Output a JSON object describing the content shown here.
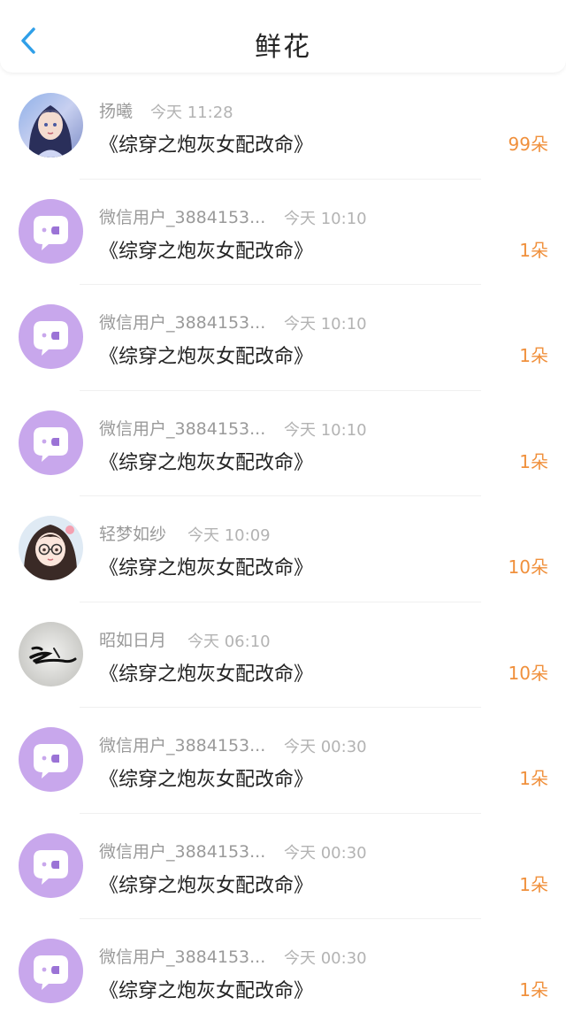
{
  "header": {
    "title": "鲜花",
    "accent": "#2f9fe8"
  },
  "colors": {
    "count": "#f0903c",
    "avatar_default": "#c8a7ec"
  },
  "items": [
    {
      "name": "扬曦",
      "time": "今天 11:28",
      "book": "《综穿之炮灰女配改命》",
      "count": "99朵",
      "avatar": "girl-anime-avatar"
    },
    {
      "name": "微信用户_3884153...",
      "time": "今天 10:10",
      "book": "《综穿之炮灰女配改命》",
      "count": "1朵",
      "avatar": "default-chat-avatar"
    },
    {
      "name": "微信用户_3884153...",
      "time": "今天 10:10",
      "book": "《综穿之炮灰女配改命》",
      "count": "1朵",
      "avatar": "default-chat-avatar"
    },
    {
      "name": "微信用户_3884153...",
      "time": "今天 10:10",
      "book": "《综穿之炮灰女配改命》",
      "count": "1朵",
      "avatar": "default-chat-avatar"
    },
    {
      "name": "轻梦如纱",
      "time": "今天 10:09",
      "book": "《综穿之炮灰女配改命》",
      "count": "10朵",
      "avatar": "girl-glasses-avatar"
    },
    {
      "name": "昭如日月",
      "time": "今天 06:10",
      "book": "《综穿之炮灰女配改命》",
      "count": "10朵",
      "avatar": "calligraphy-avatar"
    },
    {
      "name": "微信用户_3884153...",
      "time": "今天 00:30",
      "book": "《综穿之炮灰女配改命》",
      "count": "1朵",
      "avatar": "default-chat-avatar"
    },
    {
      "name": "微信用户_3884153...",
      "time": "今天 00:30",
      "book": "《综穿之炮灰女配改命》",
      "count": "1朵",
      "avatar": "default-chat-avatar"
    },
    {
      "name": "微信用户_3884153...",
      "time": "今天 00:30",
      "book": "《综穿之炮灰女配改命》",
      "count": "1朵",
      "avatar": "default-chat-avatar"
    }
  ]
}
